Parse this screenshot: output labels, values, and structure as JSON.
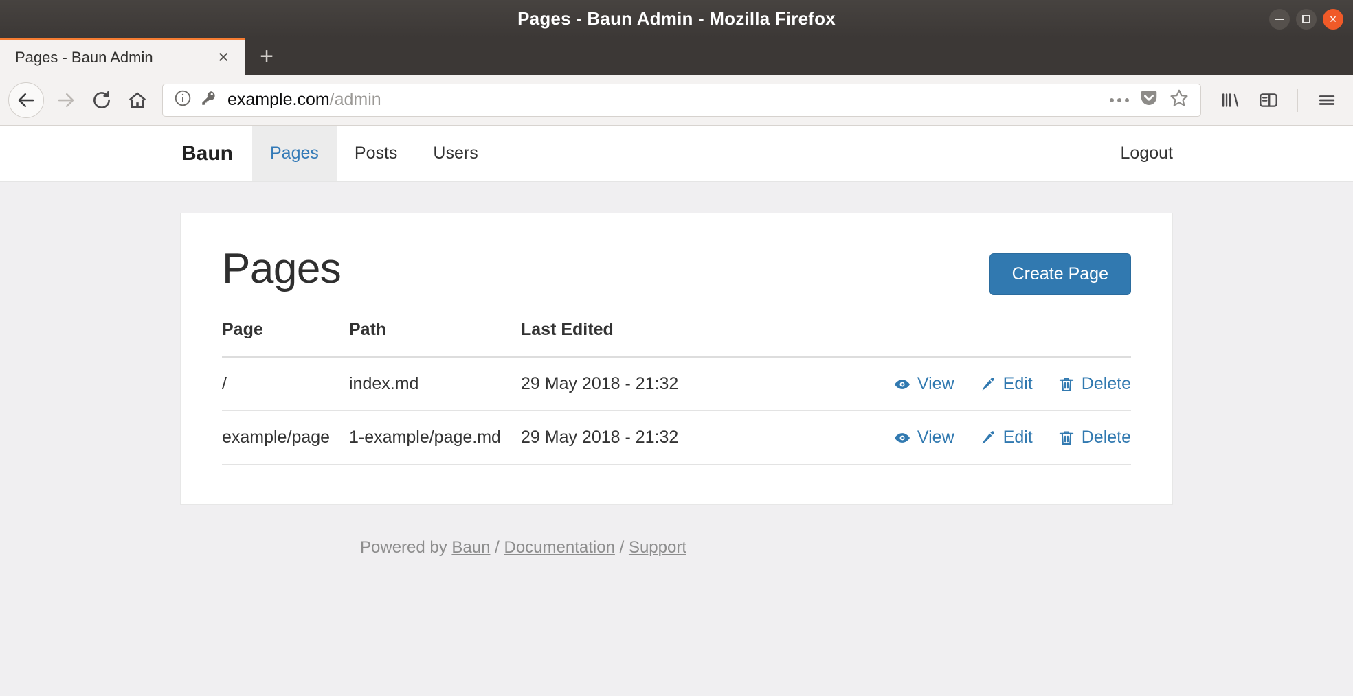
{
  "window": {
    "title": "Pages - Baun Admin - Mozilla Firefox",
    "minimize_label": "Minimize",
    "maximize_label": "Maximize",
    "close_label": "×"
  },
  "browser": {
    "tab": {
      "title": "Pages - Baun Admin",
      "close_label": "×"
    },
    "new_tab_label": "+",
    "url": {
      "host": "example.com",
      "path": "/admin"
    },
    "icons": {
      "back": "back-arrow-icon",
      "forward": "forward-arrow-icon",
      "reload": "reload-icon",
      "home": "home-icon",
      "identity": "info-circle-icon",
      "login": "key-icon",
      "page_actions": "ellipsis-icon",
      "pocket": "pocket-icon",
      "bookmark": "star-icon",
      "library": "library-icon",
      "sidebar": "sidebar-icon",
      "menu": "hamburger-menu-icon"
    }
  },
  "site_nav": {
    "brand": "Baun",
    "items": [
      {
        "label": "Pages",
        "active": true
      },
      {
        "label": "Posts",
        "active": false
      },
      {
        "label": "Users",
        "active": false
      }
    ],
    "logout_label": "Logout"
  },
  "main": {
    "title": "Pages",
    "create_button": "Create Page",
    "table": {
      "columns": [
        "Page",
        "Path",
        "Last Edited",
        ""
      ],
      "rows": [
        {
          "page": "/",
          "path": "index.md",
          "last_edited": "29 May 2018 - 21:32",
          "actions": {
            "view": "View",
            "edit": "Edit",
            "delete": "Delete"
          }
        },
        {
          "page": "example/page",
          "path": "1-example/page.md",
          "last_edited": "29 May 2018 - 21:32",
          "actions": {
            "view": "View",
            "edit": "Edit",
            "delete": "Delete"
          }
        }
      ]
    }
  },
  "footer": {
    "prefix": "Powered by ",
    "baun": "Baun",
    "sep1": " / ",
    "documentation": "Documentation",
    "sep2": " / ",
    "support": "Support"
  },
  "colors": {
    "accent_blue": "#3179b0",
    "tab_accent": "#f57c32",
    "close_button": "#f05a28",
    "page_bg": "#f0eff1"
  }
}
